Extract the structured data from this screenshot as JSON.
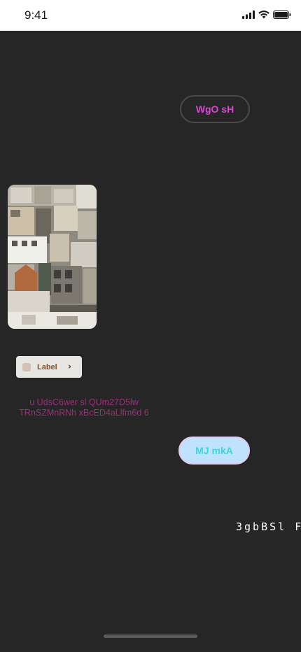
{
  "status_bar": {
    "time": "9:41",
    "icons": [
      "signal-icon",
      "wifi-icon",
      "battery-icon"
    ]
  },
  "chip_outline": {
    "label": "WgO sH"
  },
  "photo_card": {
    "image": "aerial-city-buildings-photo"
  },
  "label_chip": {
    "label": "Label",
    "icon": "chevron-right-icon"
  },
  "body_text": {
    "line1": "u UdsC6wer sl QUm27D5lw",
    "line2": "TRnSZMnRNh  xBcED4aLlfm6d 6"
  },
  "pill_filled": {
    "label": "MJ mkA"
  },
  "mono_text": {
    "value": "3gbBSl F"
  },
  "colors": {
    "background": "#262626",
    "chip_text": "#d64ad0",
    "body_text": "#9b2f7b",
    "pill_fill": "#bfe3ff",
    "pill_text": "#3fd4d8"
  }
}
